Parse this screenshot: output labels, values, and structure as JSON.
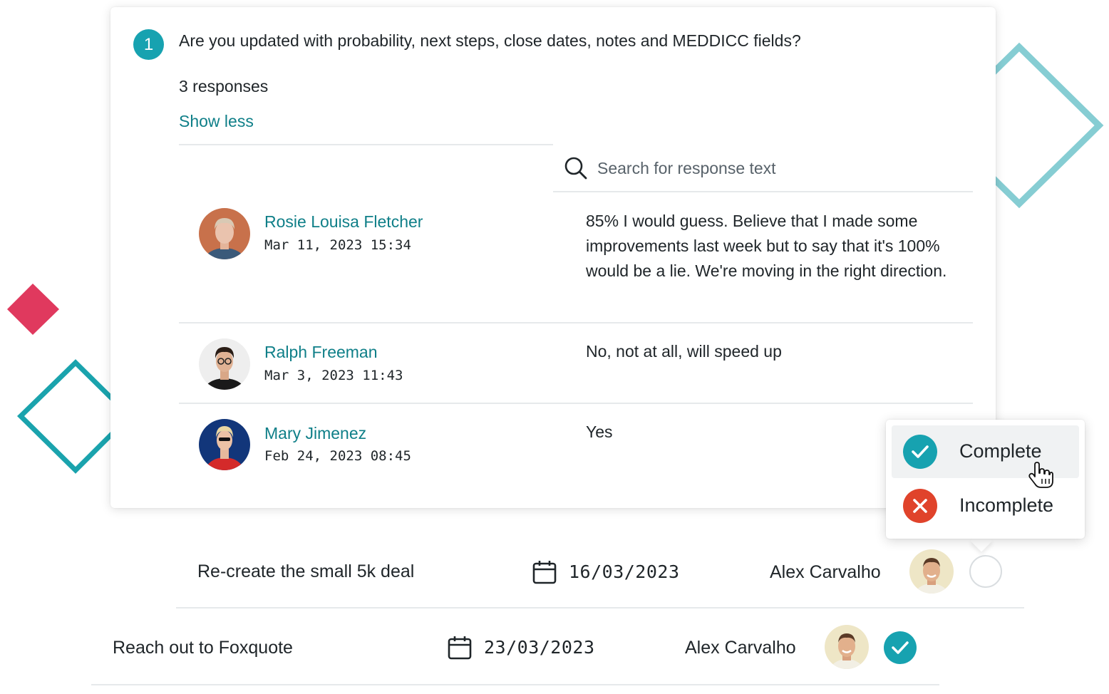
{
  "question": {
    "number": "1",
    "text": "Are you updated with probability, next steps, close dates, notes and MEDDICC fields?",
    "responses_count": "3 responses",
    "toggle_label": "Show less"
  },
  "search": {
    "placeholder": "Search for response text"
  },
  "responses": [
    {
      "name": "Rosie Louisa Fletcher",
      "date": "Mar 11, 2023 15:34",
      "text": "85% I would guess. Believe that I made some improvements last week but to say that it's 100% would be a lie. We're moving in the right direction."
    },
    {
      "name": "Ralph Freeman",
      "date": "Mar 3, 2023 11:43",
      "text": "No, not at all, will speed up"
    },
    {
      "name": "Mary Jimenez",
      "date": "Feb 24, 2023 08:45",
      "text": "Yes"
    }
  ],
  "status_menu": {
    "options": [
      {
        "label": "Complete",
        "icon": "check-icon",
        "color": "#17a2b0"
      },
      {
        "label": "Incomplete",
        "icon": "x-icon",
        "color": "#e0432b"
      }
    ]
  },
  "tasks": [
    {
      "title": "Re-create the small 5k deal",
      "date": "16/03/2023",
      "owner": "Alex Carvalho",
      "status": "empty"
    },
    {
      "title": "Reach out to Foxquote",
      "date": "23/03/2023",
      "owner": "Alex Carvalho",
      "status": "complete"
    }
  ],
  "colors": {
    "accent": "#17a2b0",
    "link": "#0f7f88",
    "danger": "#e0432b",
    "deco_red": "#e0395e",
    "deco_teal": "#1aa3ad",
    "deco_teal_light": "#86cdd3"
  }
}
